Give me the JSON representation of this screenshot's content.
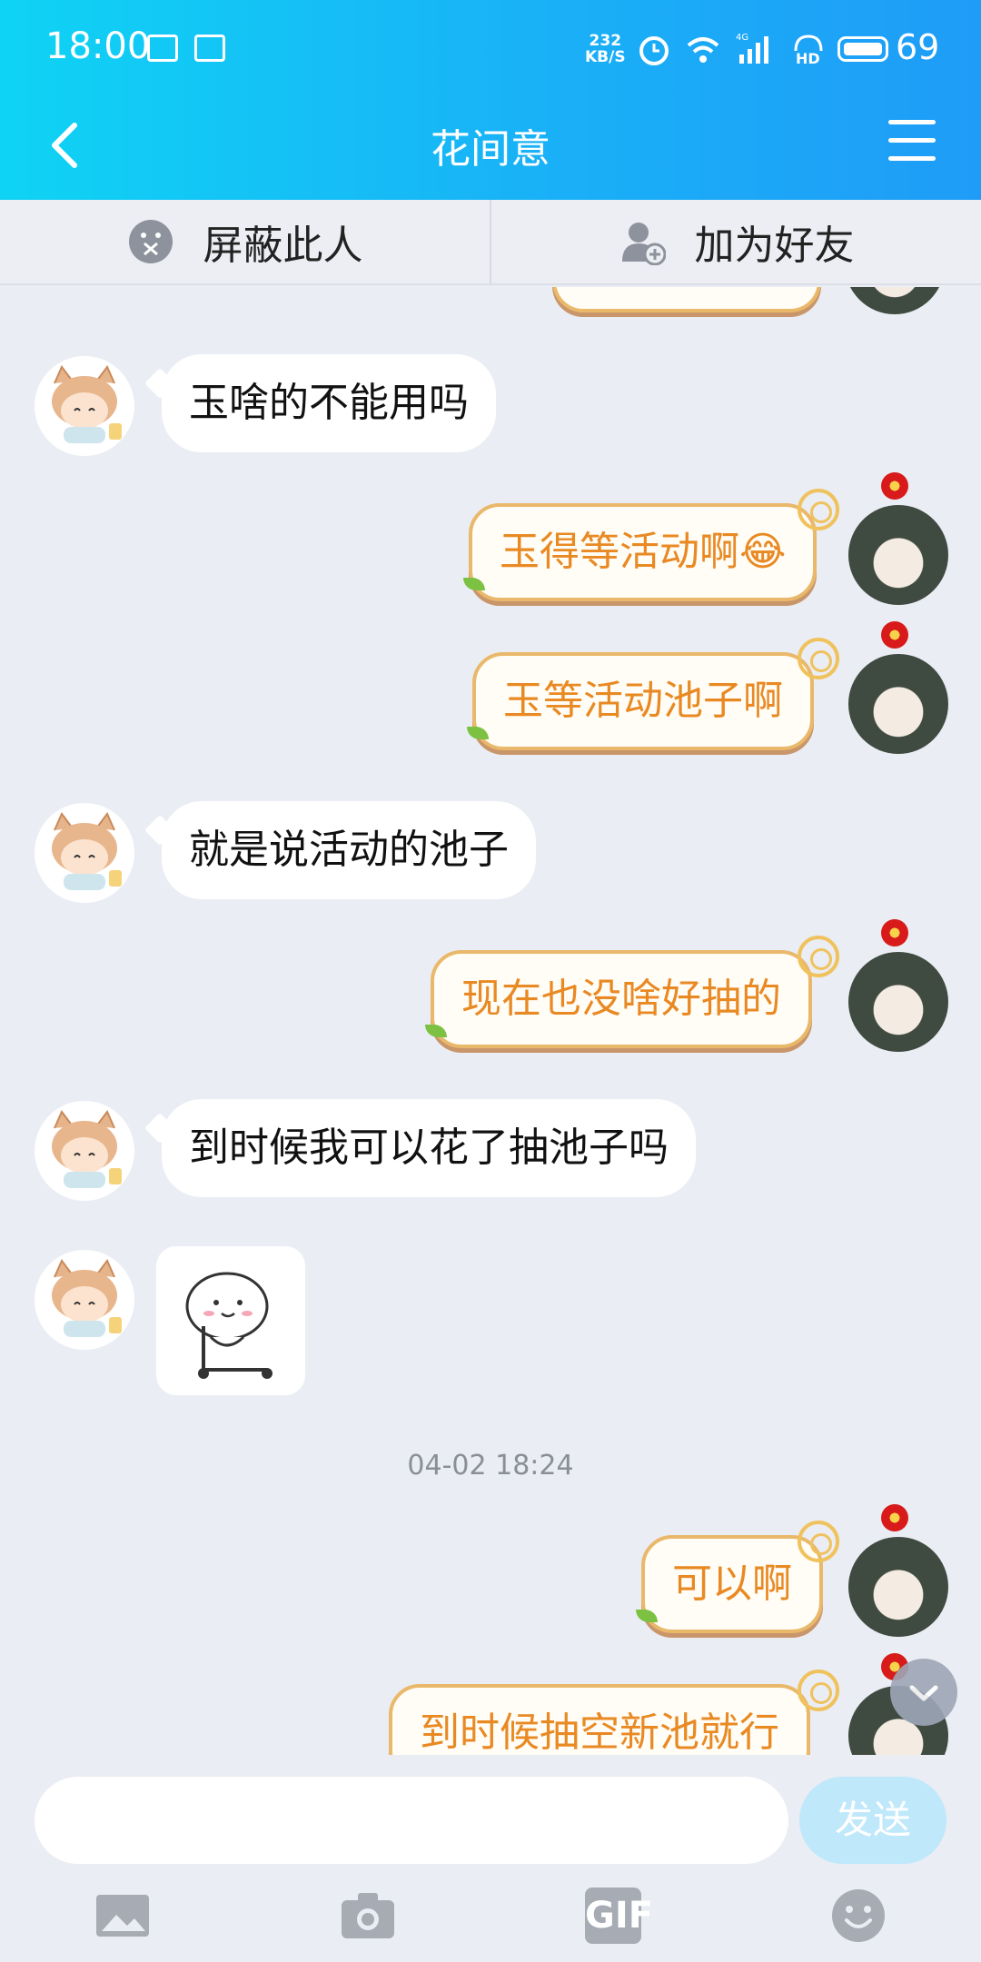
{
  "status_bar": {
    "time": "18:00",
    "net_speed_value": "232",
    "net_speed_unit": "KB/S",
    "network": "4G",
    "hd": "HD",
    "battery": "69"
  },
  "header": {
    "title": "花间意"
  },
  "actions": {
    "block": "屏蔽此人",
    "add_friend": "加为好友"
  },
  "messages": [
    {
      "side": "left",
      "text": "玉啥的不能用吗"
    },
    {
      "side": "right",
      "text": "玉得等活动啊😂"
    },
    {
      "side": "right",
      "text": "玉等活动池子啊"
    },
    {
      "side": "left",
      "text": "就是说活动的池子"
    },
    {
      "side": "right",
      "text": "现在也没啥好抽的"
    },
    {
      "side": "left",
      "text": "到时候我可以花了抽池子吗"
    },
    {
      "side": "left",
      "text": ""
    },
    {
      "side": "right",
      "text": "可以啊"
    },
    {
      "side": "right",
      "text": "到时候抽空新池就行"
    }
  ],
  "timestamp": "04-02 18:24",
  "composer": {
    "placeholder": "",
    "send_label": "发送",
    "gif_label": "GIF"
  },
  "colors": {
    "header_start": "#0fd3f4",
    "header_end": "#1f9cf7",
    "bubble_right_text": "#e98923",
    "send_bg": "#bfe8fb"
  }
}
